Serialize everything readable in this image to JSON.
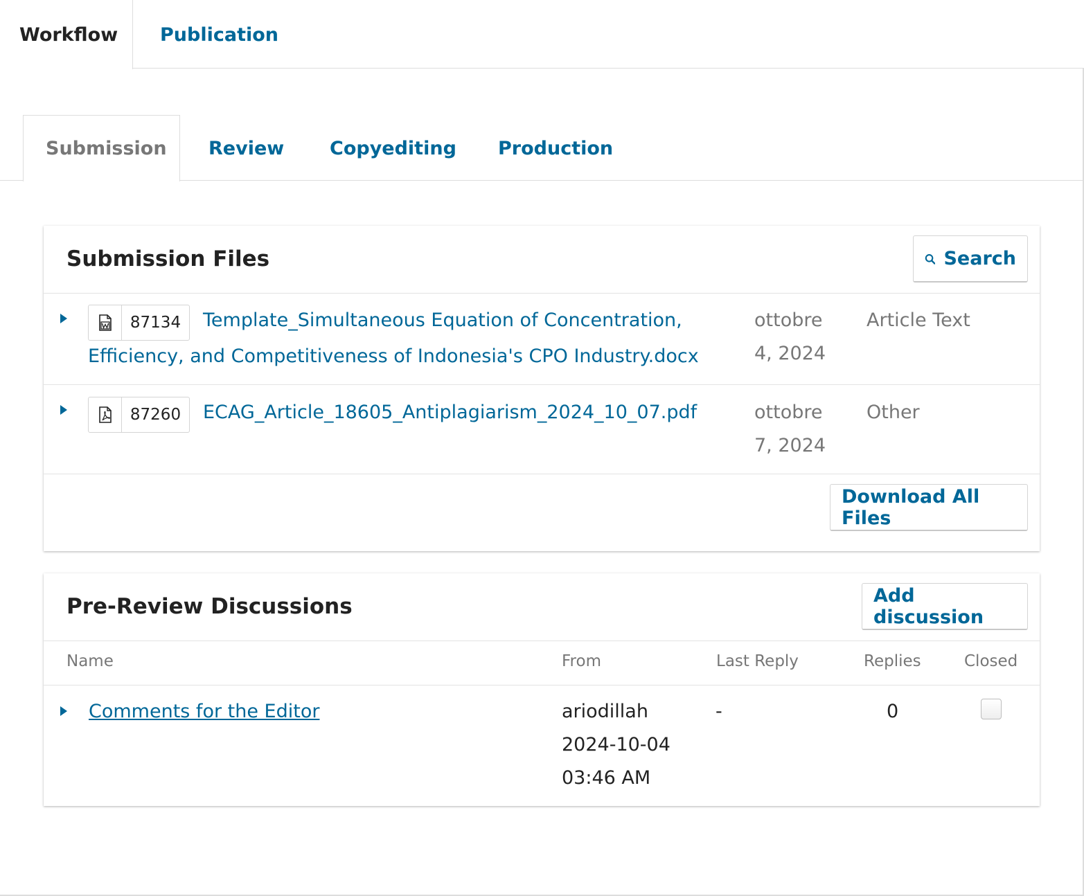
{
  "top_tabs": [
    {
      "label": "Workflow",
      "active": true
    },
    {
      "label": "Publication",
      "active": false
    }
  ],
  "stage_tabs": [
    {
      "label": "Submission",
      "active": true
    },
    {
      "label": "Review"
    },
    {
      "label": "Copyediting"
    },
    {
      "label": "Production"
    }
  ],
  "submission_files": {
    "title": "Submission Files",
    "search_label": "Search",
    "files": [
      {
        "id": "87134",
        "icon": "word-document-icon",
        "name": "Template_Simultaneous Equation of Concentration, Efficiency, and Competitiveness of Indonesia's CPO Industry.docx",
        "name_line1": "Template_Simultaneous Equation of Concentration,",
        "name_line2": "Efficiency, and Competitiveness of Indonesia's CPO Industry.docx",
        "date_line1": "ottobre",
        "date_line2": "4, 2024",
        "type": "Article Text"
      },
      {
        "id": "87260",
        "icon": "pdf-document-icon",
        "name": "ECAG_Article_18605_Antiplagiarism_2024_10_07.pdf",
        "date_line1": "ottobre",
        "date_line2": "7, 2024",
        "type": "Other"
      }
    ],
    "download_all_label": "Download All Files"
  },
  "discussions": {
    "title": "Pre-Review Discussions",
    "add_label": "Add discussion",
    "columns": [
      "Name",
      "From",
      "Last Reply",
      "Replies",
      "Closed"
    ],
    "rows": [
      {
        "name": "Comments for the Editor",
        "from_user": "ariodillah",
        "from_date": "2024-10-04",
        "from_time": "03:46 AM",
        "last_reply": "-",
        "replies": "0",
        "closed": false
      }
    ]
  },
  "colors": {
    "link": "#006798",
    "border": "#dddddd",
    "muted_text": "#777777"
  }
}
